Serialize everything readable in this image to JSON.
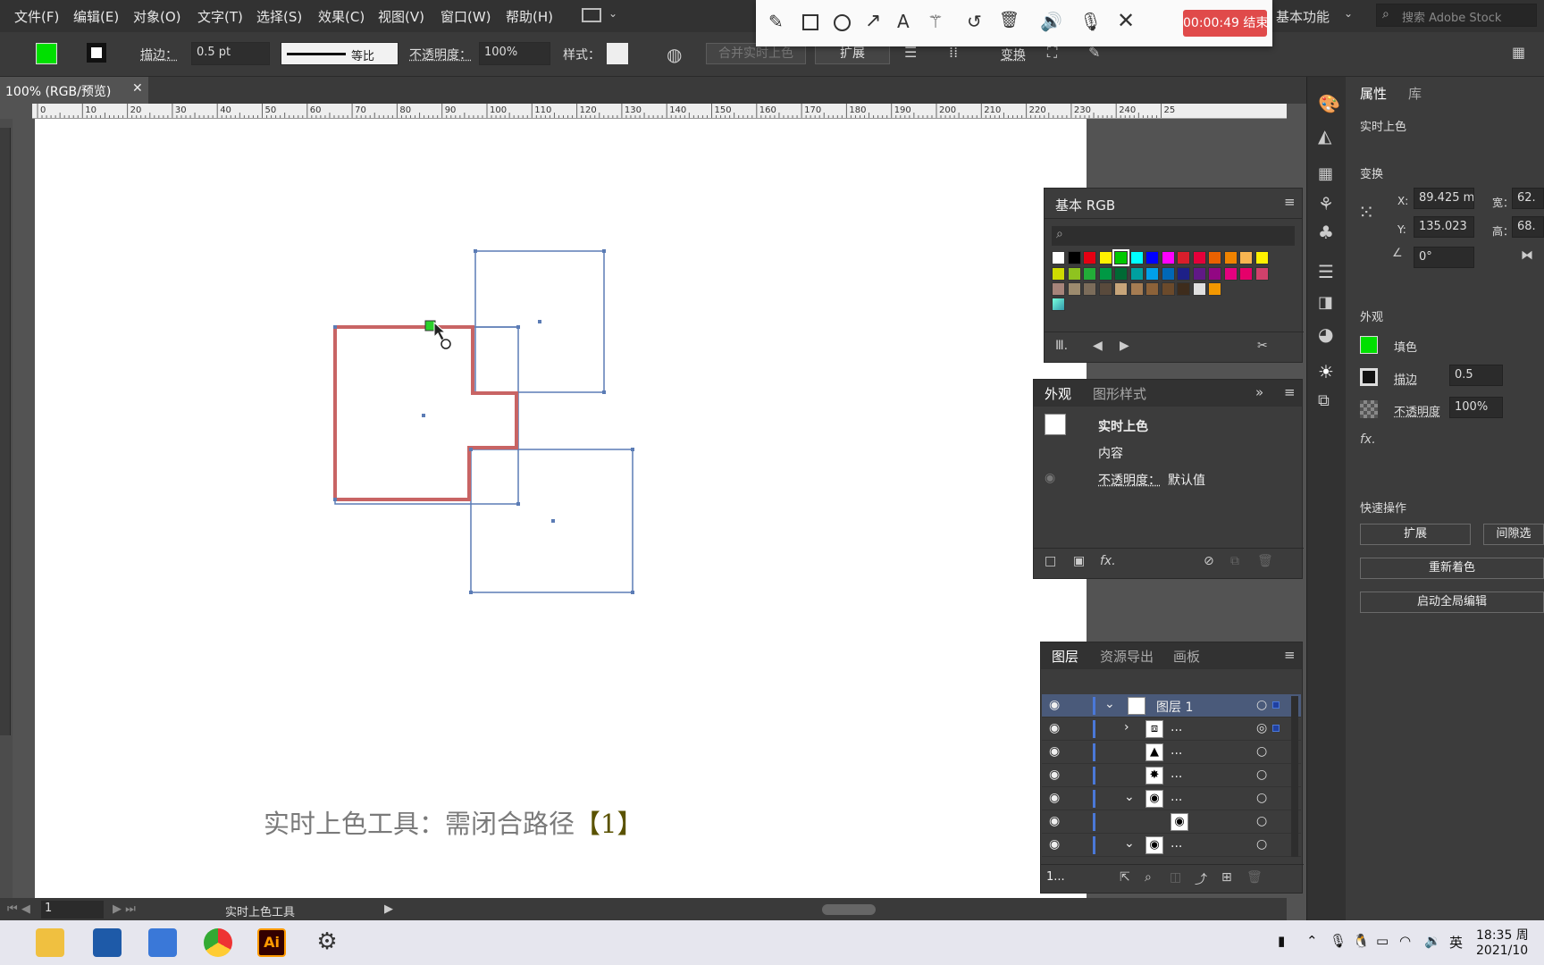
{
  "menu": [
    "文件(F)",
    "编辑(E)",
    "对象(O)",
    "文字(T)",
    "选择(S)",
    "效果(C)",
    "视图(V)",
    "窗口(W)",
    "帮助(H)"
  ],
  "workspace": "基本功能",
  "search_placeholder": "搜索 Adobe Stock",
  "control": {
    "stroke_label": "描边：",
    "stroke_value": "0.5 pt",
    "profile_label": "等比",
    "opacity_label": "不透明度：",
    "opacity_value": "100%",
    "style_label": "样式：",
    "merge_label": "合并实时上色",
    "expand_label": "扩展",
    "transform_label": "变换"
  },
  "recorder": {
    "timer": "00:00:49 结束"
  },
  "document": {
    "tab_title": "100% (RGB/预览)"
  },
  "ruler_labels": [
    "0",
    "10",
    "20",
    "30",
    "40",
    "50",
    "60",
    "70",
    "80",
    "90",
    "100",
    "110",
    "120",
    "130",
    "140",
    "150",
    "160",
    "170",
    "180",
    "190",
    "200",
    "210",
    "220",
    "230",
    "240",
    "25"
  ],
  "canvas": {
    "caption_main": "实时上色工具：需闭合路径",
    "caption_tag": "【1】"
  },
  "status": {
    "page": "1",
    "tool_name": "实时上色工具"
  },
  "swatches_panel": {
    "title": "基本 RGB",
    "colors": [
      "#ffffff",
      "#000000",
      "#e60012",
      "#fff100",
      "#00c800",
      "#00ffff",
      "#0000ff",
      "#ff00ff",
      "#d91e2b",
      "#e4003a",
      "#eb6100",
      "#f08300",
      "#f8b551",
      "#fff100",
      "#cfdb00",
      "#8fc31f",
      "#22ac38",
      "#009944",
      "#006934",
      "#00a0a0",
      "#00a0e9",
      "#0068b7",
      "#1d2088",
      "#601986",
      "#920783",
      "#e4007f",
      "#e5006a",
      "#d1416b",
      "#a6847a",
      "#9c8b6e",
      "#7b6c5a",
      "#594a3c",
      "#c7a57a",
      "#a57c52",
      "#8c6239",
      "#6b4a2b",
      "#3e2c1c",
      "#e0e0e0",
      "#f39800"
    ]
  },
  "appearance_panel": {
    "tabs": [
      "外观",
      "图形样式"
    ],
    "title": "实时上色",
    "content_label": "内容",
    "opacity_label": "不透明度：",
    "opacity_value": "默认值"
  },
  "layers_panel": {
    "tabs": [
      "图层",
      "资源导出",
      "画板"
    ],
    "layer_name": "图层 1",
    "sublayer_label": "...",
    "footer_count": "1..."
  },
  "properties_panel": {
    "tabs": [
      "属性",
      "库"
    ],
    "object_type": "实时上色",
    "transform_title": "变换",
    "x_label": "X:",
    "x_value": "89.425 m",
    "y_label": "Y:",
    "y_value": "135.023",
    "w_label": "宽：",
    "w_value": "62.",
    "h_label": "高：",
    "h_value": "68.",
    "angle_value": "0°",
    "appearance_title": "外观",
    "fill_label": "填色",
    "stroke_label": "描边",
    "stroke_value": "0.5",
    "opacity_label": "不透明度",
    "opacity_value": "100%",
    "quick_actions_title": "快速操作",
    "expand_button": "扩展",
    "gap_button": "间隙选",
    "recolor_button": "重新着色",
    "global_edit_button": "启动全局编辑"
  },
  "taskbar": {
    "ime": "英",
    "time": "18:35 周",
    "date": "2021/10"
  },
  "colors": {
    "fill": "#00e000",
    "live_paint_stroke": "#c86464",
    "path_blue": "#5b7cb5",
    "record_button": "#e04a4a"
  }
}
